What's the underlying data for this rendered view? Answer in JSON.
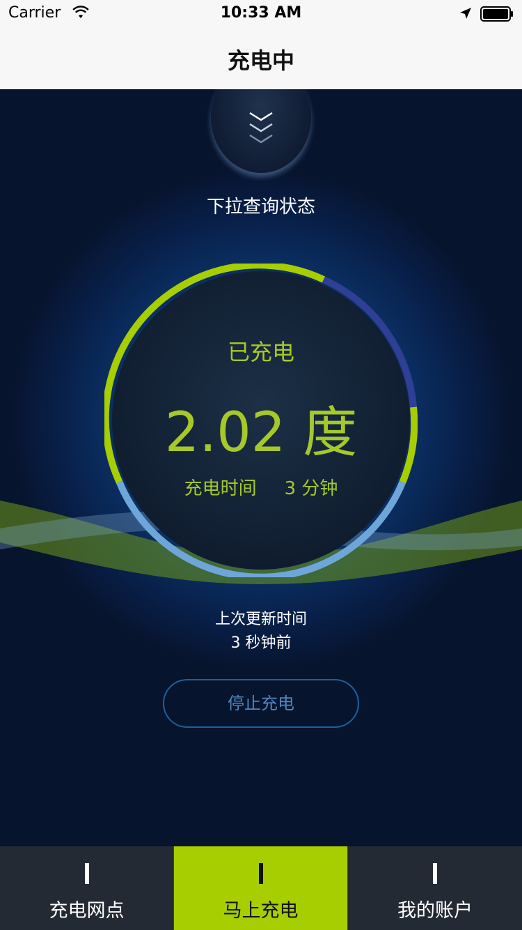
{
  "status_bar": {
    "carrier": "Carrier",
    "time": "10:33 AM",
    "wifi_icon": "wifi-icon",
    "location_icon": "location-arrow-icon",
    "battery_icon": "battery-full-icon"
  },
  "nav": {
    "title": "充电中"
  },
  "pull": {
    "hint": "下拉查询状态",
    "icon": "chevron-down-triple-icon"
  },
  "charge": {
    "label": "已充电",
    "value": "2.02 度",
    "duration_label": "充电时间",
    "duration_value": "3 分钟",
    "progress_fraction": 0.5
  },
  "update": {
    "label": "上次更新时间",
    "value": "3 秒钟前"
  },
  "actions": {
    "stop_label": "停止充电"
  },
  "tabs": [
    {
      "label": "充电网点",
      "icon": "bar-icon",
      "active": false
    },
    {
      "label": "马上充电",
      "icon": "bar-icon",
      "active": true
    },
    {
      "label": "我的账户",
      "icon": "bar-icon",
      "active": false
    }
  ],
  "colors": {
    "accent_green": "#a7ce00",
    "text_green": "#a6c92a",
    "ring_blue": "#6fa6da",
    "ring_dark_blue": "#2e3f95",
    "background_dark": "#07142e",
    "tab_bar": "#232a34",
    "button_border": "#1e5f9a"
  }
}
